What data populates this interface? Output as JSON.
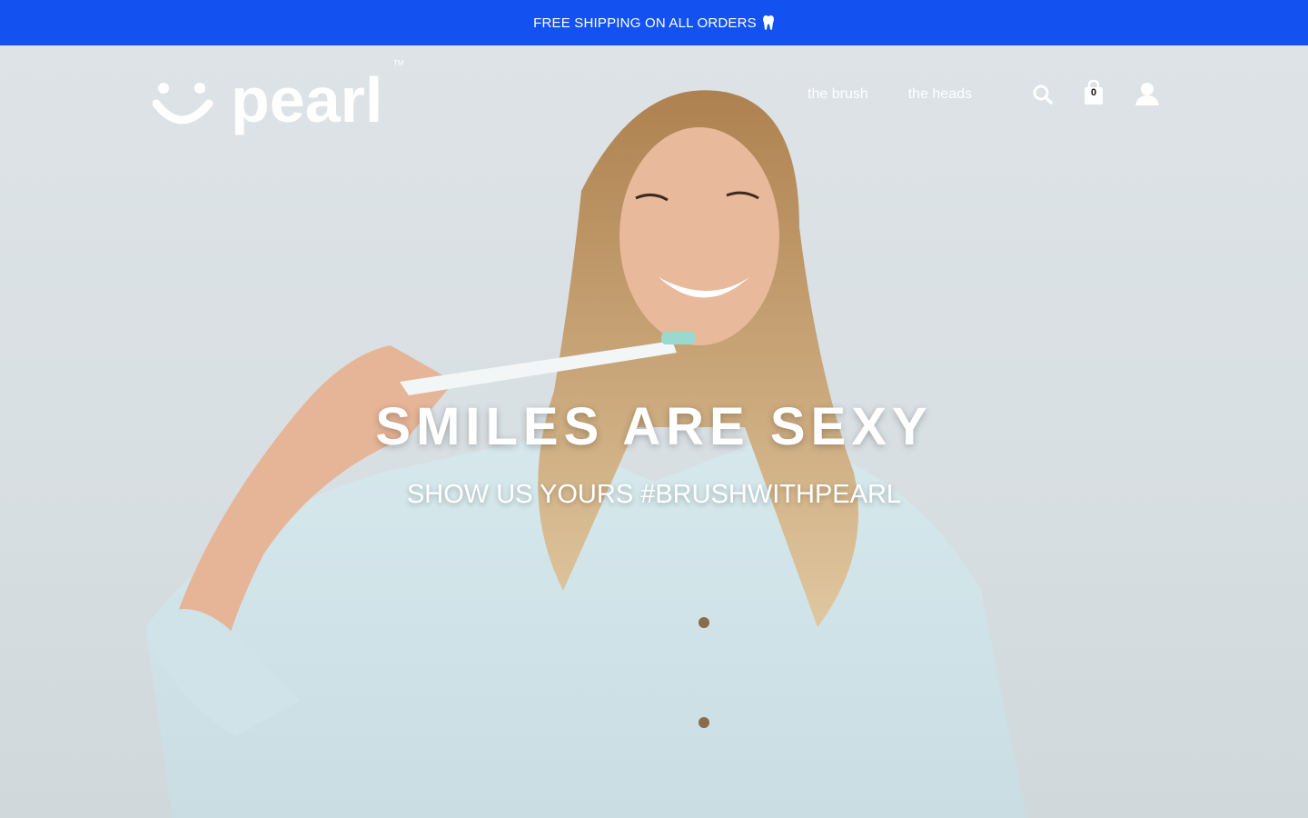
{
  "announcement": {
    "text": "FREE SHIPPING ON ALL ORDERS",
    "icon": "tooth-icon"
  },
  "brand": {
    "name": "pearl",
    "trademark": "TM",
    "logo_icon": "smiley-icon"
  },
  "nav": {
    "items": [
      {
        "label": "the brush"
      },
      {
        "label": "the heads"
      }
    ]
  },
  "header_icons": {
    "search": "search-icon",
    "cart": "shopping-bag-icon",
    "account": "user-icon"
  },
  "cart": {
    "count": "0"
  },
  "hero": {
    "headline": "SMILES ARE SEXY",
    "subheadline": "SHOW US YOURS #BRUSHWITHPEARL"
  },
  "colors": {
    "announcement_bg": "#1352f1",
    "text_on_hero": "#ffffff"
  }
}
